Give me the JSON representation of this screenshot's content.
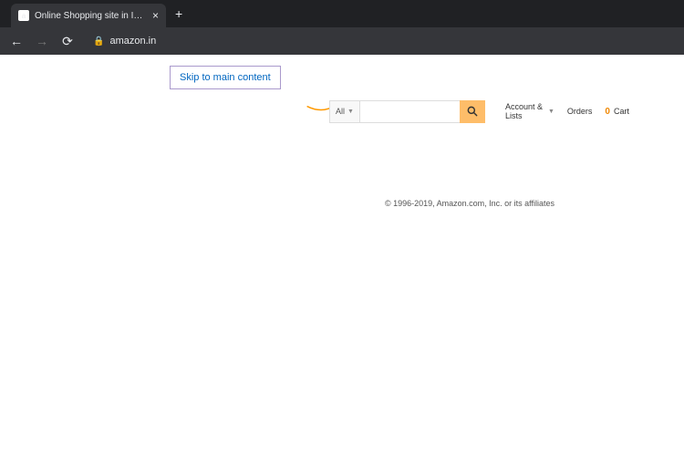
{
  "browser": {
    "tab_title": "Online Shopping site in India: Shop",
    "url": "amazon.in"
  },
  "page": {
    "skip_link": "Skip to main content",
    "search": {
      "category": "All",
      "placeholder": ""
    },
    "nav": {
      "account": "Account & Lists",
      "orders": "Orders",
      "cart_count": "0",
      "cart_label": "Cart"
    },
    "footer": "© 1996-2019, Amazon.com, Inc. or its affiliates"
  }
}
